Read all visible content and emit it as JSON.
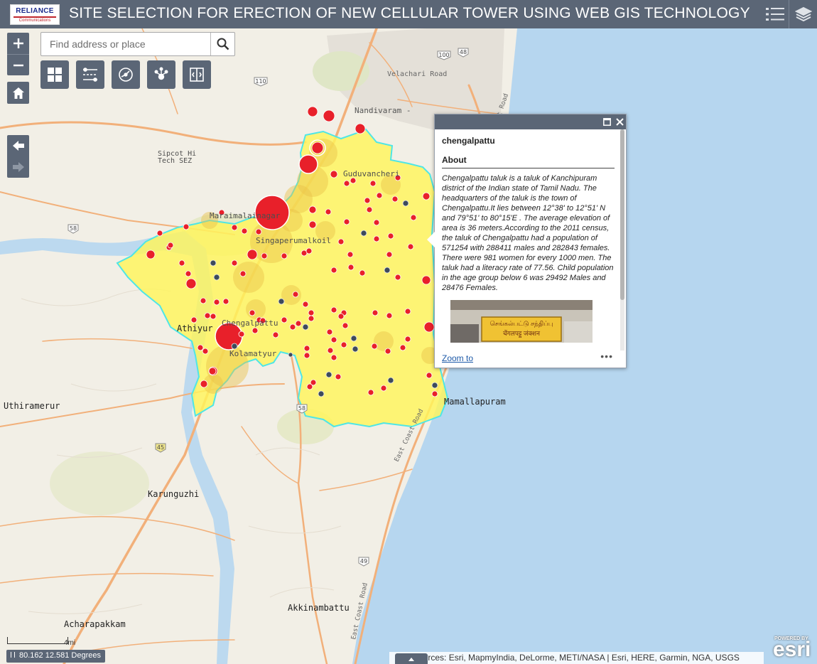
{
  "header": {
    "logo_brand": "RELIANCE",
    "logo_sub": "Communications",
    "title": "SITE SELECTION FOR ERECTION OF NEW CELLULAR TOWER USING WEB GIS TECHNOLOGY"
  },
  "search": {
    "placeholder": "Find address or place"
  },
  "map_labels": {
    "velachari": "Velachari Road",
    "nandivaram": "Nandivaram -",
    "guduvancheri": "Guduvancheri",
    "sipcot": "Sipcot Hi",
    "tech_sez": "Tech SEZ",
    "maraimalai": "Maraimalainagar",
    "singaperumal": "Singaperumalkoil",
    "chengalpattu": "Chengalpattu",
    "athiyur": "Athiyur",
    "kolamatyur": "Kolamatyur",
    "uthiramerur": "Uthiramerur",
    "mamallapuram": "Mamallapuram",
    "karunguzhi": "Karunguzhi",
    "akkinambattu": "Akkinambattu",
    "acharapakkam": "Acharapakkam",
    "east_coast_road": "East Coast Road",
    "shield_58": "58",
    "shield_45": "45",
    "shield_49": "49",
    "shield_110": "110",
    "shield_100": "100",
    "shield_48": "48"
  },
  "popup": {
    "title": "chengalpattu",
    "section": "About",
    "description": "Chengalpattu taluk is a taluk of Kanchipuram district of the Indian state of Tamil Nadu. The headquarters of the taluk is the town of Chengalpattu.It lies between 12°38' to 12°51' N and 79°51' to 80°15'E . The average elevation of area is 36 meters.According to the 2011 census, the taluk of Chengalpattu had a population of 571254 with 288411 males and 282843 females. There were 981 women for every 1000 men. The taluk had a literacy rate of 77.56. Child population in the age group below 6 was 29492 Males and 28476 Females.",
    "photo_sign_top": "செங்கல்பட்டு சந்திப்பு",
    "photo_sign_bottom": "चेंगलपट्टु जंक्शन",
    "zoom_link": "Zoom to",
    "more": "•••"
  },
  "footer": {
    "scale": "4mi",
    "coordinates": "80.162 12.581 Degrees",
    "attribution": "Sources: Esri, MapmyIndia, DeLorme, METI/NASA | Esri, HERE, Garmin, NGA, USGS",
    "esri_powered": "POWERED BY",
    "esri_word": "esri"
  },
  "colors": {
    "header": "#5b6676",
    "land": "#f2efe6",
    "sea": "#b6d6ef",
    "taluk_fill": "#fff55a",
    "taluk_border": "#4ee6e6",
    "tower_red": "#e8202a",
    "tower_grey": "#3d4a5c",
    "road": "#f2b07a"
  },
  "icons": [
    "zoom-in-icon",
    "zoom-out-icon",
    "home-icon",
    "back-arrow-icon",
    "forward-arrow-icon",
    "search-icon",
    "basemap-gallery-icon",
    "layer-list-tool-icon",
    "measure-icon",
    "share-icon",
    "swipe-icon",
    "list-icon",
    "layers-icon",
    "maximize-icon",
    "close-icon"
  ]
}
